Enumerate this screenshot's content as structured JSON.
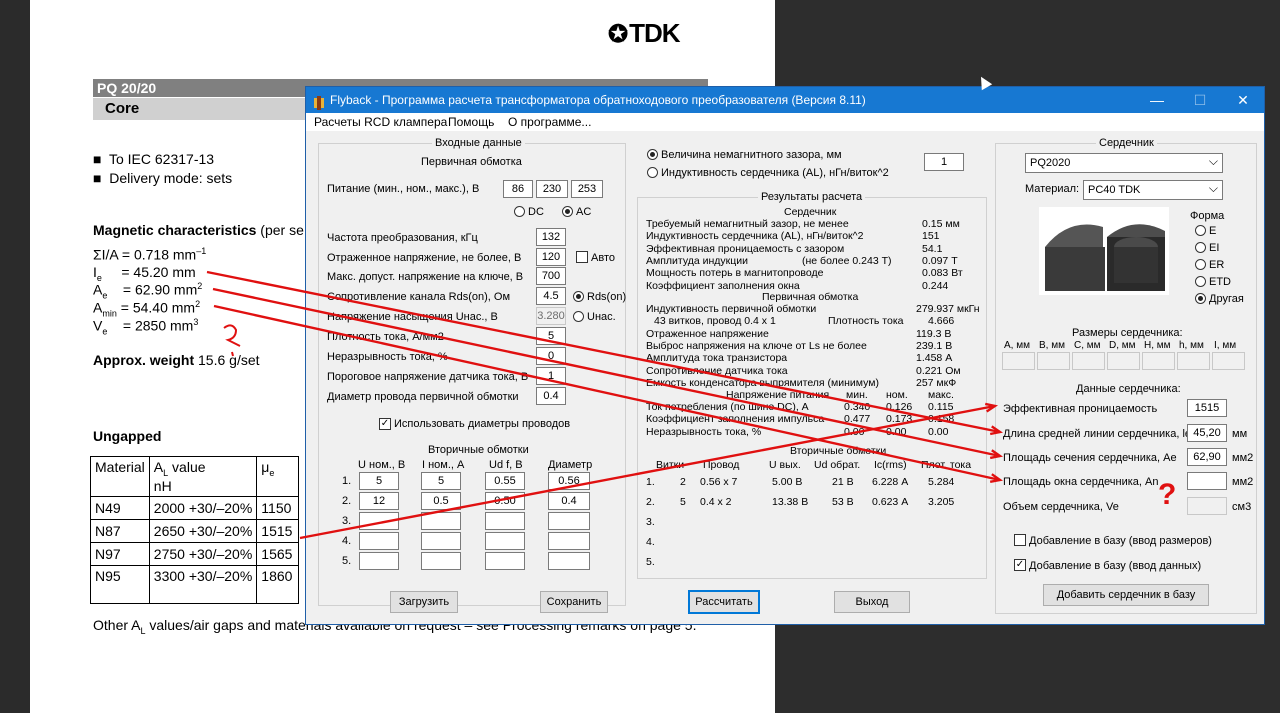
{
  "pdf": {
    "logo": "TDK",
    "part": "PQ 20/20",
    "section": "Core",
    "bullets": [
      "To IEC 62317-13",
      "Delivery mode: sets"
    ],
    "mag_title": "Magnetic characteristics",
    "mag_suffix": "(per se",
    "sigma": "ΣI/A  = 0.718 mm",
    "sigma_exp": "–1",
    "le": "I",
    "le_sub": "e",
    "le_val": "= 45.20 mm",
    "ae": "A",
    "ae_sub": "e",
    "ae_val": "= 62.90 mm",
    "sq": "2",
    "amin": "A",
    "amin_sub": "min",
    "amin_val": "= 54.40 mm",
    "ve": "V",
    "ve_sub": "e",
    "ve_val": "= 2850 mm",
    "cube": "3",
    "weight_label": "Approx. weight",
    "weight_val": "15.6 g/set",
    "ungapped": "Ungapped",
    "table_header": [
      "Material",
      "A",
      "L",
      " value",
      "nH",
      "μ",
      "e"
    ],
    "rows": [
      [
        "N49",
        "2000 +30/–20%",
        "1150"
      ],
      [
        "N87",
        "2650 +30/–20%",
        "1515"
      ],
      [
        "N97",
        "2750 +30/–20%",
        "1565"
      ],
      [
        "N95",
        "3300 +30/–20%",
        "1860"
      ]
    ],
    "footer": "Other A",
    "footer_sub": "L",
    "footer_rest": " values/air gaps and materials available on request – see Processing remarks on page 5."
  },
  "window": {
    "title": "Flyback - Программа расчета трансформатора обратноходового преобразователя (Версия 8.11)",
    "controls": [
      "—",
      "☐",
      "✕"
    ],
    "menu": [
      "Расчеты RCD клампера",
      "Помощь",
      "О программе..."
    ]
  },
  "input": {
    "group": "Входные данные",
    "primary": "Первичная обмотка",
    "supply_label": "Питание (мин., ном., макс.), В",
    "supply": [
      "86",
      "230",
      "253"
    ],
    "dc": "DC",
    "ac": "AC",
    "freq_label": "Частота преобразования, кГц",
    "freq": "132",
    "refl_label": "Отраженное напряжение, не более, В",
    "refl": "120",
    "auto": "Авто",
    "vmax_label": "Макс. допуст. напряжение на ключе, В",
    "vmax": "700",
    "rds_label": "Сопротивление канала Rds(on), Ом",
    "rds": "4.5",
    "rds_opt": "Rds(on)",
    "usat_label": "Напряжение насыщения Uнас., В",
    "usat": "3.280",
    "usat_opt": "Uнас.",
    "jd_label": "Плотность тока, А/мм2",
    "jd": "5",
    "cont_label": "Неразрывность тока, %",
    "cont": "0",
    "sense_label": "Пороговое напряжение датчика тока, В",
    "sense": "1",
    "wire_label": "Диаметр провода первичной обмотки",
    "wire": "0.4",
    "use_diam": "Использовать диаметры проводов",
    "secondary": "Вторичные обмотки",
    "sec_headers": [
      "U ном., В",
      "I ном., А",
      "Ud f, В",
      "Диаметр"
    ],
    "sec_rows": [
      [
        "1.",
        "5",
        "5",
        "0.55",
        "0.56"
      ],
      [
        "2.",
        "12",
        "0.5",
        "0.50",
        "0.4"
      ],
      [
        "3.",
        "",
        "",
        "",
        ""
      ],
      [
        "4.",
        "",
        "",
        "",
        ""
      ],
      [
        "5.",
        "",
        "",
        "",
        ""
      ]
    ]
  },
  "gap": {
    "opt1": "Величина немагнитного зазора, мм",
    "opt2": "Индуктивность сердечника (AL), нГн/виток^2",
    "value": "1"
  },
  "results": {
    "group": "Результаты расчета",
    "core": "Сердечник",
    "lines": [
      [
        "Требуемый немагнитный зазор, не менее",
        "0.15 мм"
      ],
      [
        "Индуктивность сердечника (AL), нГн/виток^2",
        "151"
      ],
      [
        "Эффективная проницаемость с зазором",
        "54.1"
      ],
      [
        "Амплитуда индукции",
        "(не более 0.243 Т)",
        "0.097 Т"
      ],
      [
        "Мощность потерь в магнитопроводе",
        "0.083 Вт"
      ],
      [
        "Коэффициент заполнения окна",
        "0.244"
      ]
    ],
    "primary": "Первичная обмотка",
    "plines": [
      [
        "Индуктивность первичной обмотки",
        "279.937 мкГн"
      ],
      [
        "43 витков, провод 0.4 x 1",
        "Плотность тока",
        "4.666"
      ],
      [
        "Отраженное напряжение",
        "119.3 В"
      ],
      [
        "Выброс напряжения на ключе от Ls не более",
        "239.1 В"
      ],
      [
        "Амплитуда тока транзистора",
        "1.458 А"
      ],
      [
        "Сопротивление датчика тока",
        "0.221 Ом"
      ],
      [
        "Емкость конденсатора выпрямителя (минимум)",
        "257 мкФ"
      ]
    ],
    "ptable_head": [
      "Напряжение питания",
      "мин.",
      "ном.",
      "макс."
    ],
    "ptable": [
      [
        "Ток потребления (по шине DC), А",
        "0.340",
        "0.126",
        "0.115"
      ],
      [
        "Коэффициент заполнения импульса",
        "0.477",
        "0.173",
        "0.158"
      ],
      [
        "Неразрывность тока, %",
        "0.00",
        "0.00",
        "0.00"
      ]
    ],
    "sec_title": "Вторичные обмотки",
    "sec_head": [
      "Витки",
      "Провод",
      "U вых.",
      "Ud обрат.",
      "Ic(rms)",
      "Плот. тока"
    ],
    "sec_rows": [
      [
        "1.",
        "2",
        "0.56 x 7",
        "5.00 В",
        "21 В",
        "6.228 А",
        "5.284"
      ],
      [
        "2.",
        "5",
        "0.4 x 2",
        "13.38 В",
        "53 В",
        "0.623 А",
        "3.205"
      ],
      [
        "3."
      ],
      [
        "4."
      ],
      [
        "5."
      ]
    ]
  },
  "buttons": {
    "load": "Загрузить",
    "save": "Сохранить",
    "calc": "Рассчитать",
    "exit": "Выход"
  },
  "corepanel": {
    "group": "Сердечник",
    "core": "PQ2020",
    "mat_label": "Материал:",
    "material": "PC40 TDK",
    "shape_label": "Форма",
    "shapes": [
      "E",
      "EI",
      "ER",
      "ETD",
      "Другая"
    ],
    "dims_label": "Размеры сердечника:",
    "dims": [
      "A, мм",
      "B, мм",
      "C, мм",
      "D, мм",
      "H, мм",
      "h, мм",
      "I, мм"
    ],
    "data_label": "Данные сердечника:",
    "mu_label": "Эффективная проницаемость",
    "mu": "1515",
    "le_label": "Длина средней линии сердечника, le",
    "le": "45,20",
    "le_unit": "мм",
    "ae_label": "Площадь сечения сердечника, Ae",
    "ae": "62,90",
    "ae_unit": "мм2",
    "an_label": "Площадь окна сердечника, An",
    "an": "",
    "an_unit": "мм2",
    "ve_label": "Объем сердечника, Ve",
    "ve": "",
    "ve_unit": "см3",
    "add_dims": "Добавление в базу (ввод размеров)",
    "add_data": "Добавление в базу (ввод данных)",
    "add_btn": "Добавить сердечник в базу"
  },
  "annotations": {
    "q_left": "?",
    "q_right": "?"
  },
  "colors": {
    "title_bar": "#1778d2",
    "annotation": "#e01010"
  }
}
